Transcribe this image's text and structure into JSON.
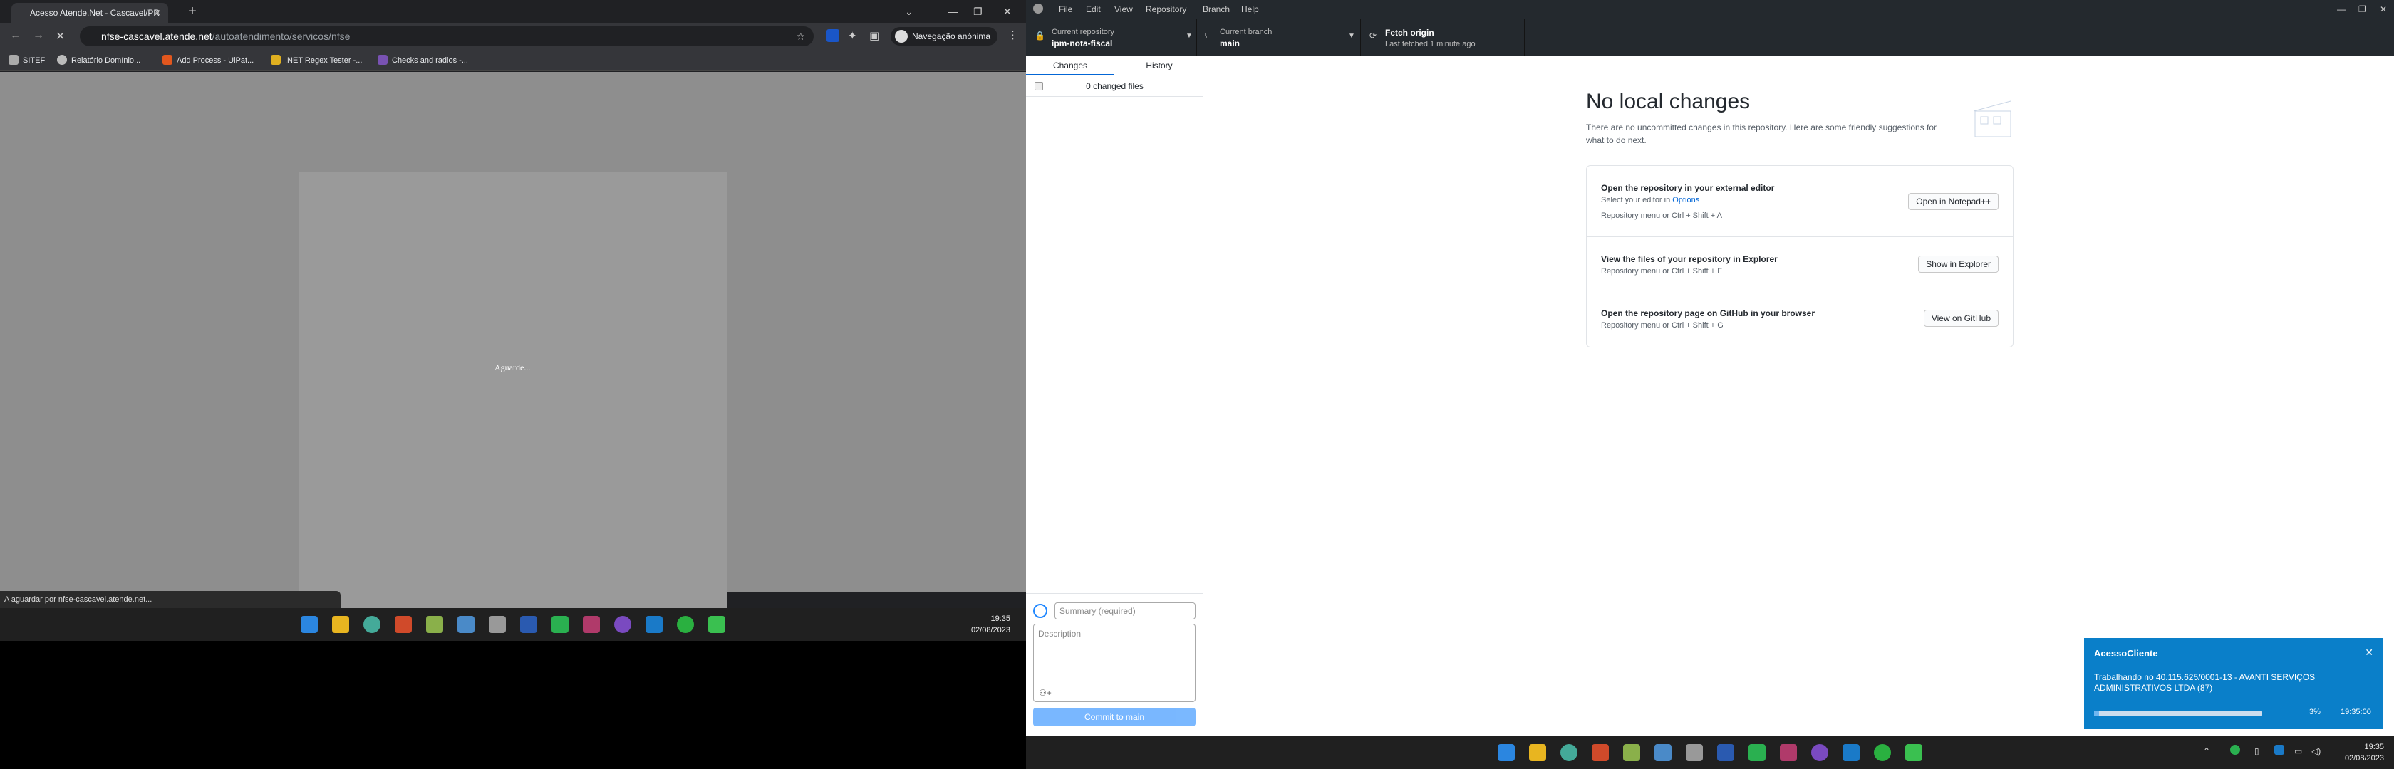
{
  "browser": {
    "tab_title": "Acesso Atende.Net - Cascavel/PR",
    "url_host": "nfse-cascavel.atende.net",
    "url_path": "/autoatendimento/servicos/nfse",
    "profile_label": "Navegação anónima",
    "bookmarks": [
      "SITEF",
      "Relatório Domínio...",
      "Add Process - UiPat...",
      ".NET Regex Tester -...",
      "Checks and radios -..."
    ],
    "loading_text": "Aguarde...",
    "status_text": "A aguardar por nfse-cascavel.atende.net...",
    "clock_time": "19:35",
    "clock_date": "02/08/2023"
  },
  "github": {
    "menu": [
      "File",
      "Edit",
      "View",
      "Repository",
      "Branch",
      "Help"
    ],
    "repo_label": "Current repository",
    "repo_name": "ipm-nota-fiscal",
    "branch_label": "Current branch",
    "branch_name": "main",
    "fetch_label": "Fetch origin",
    "fetch_sub": "Last fetched 1 minute ago",
    "tab_changes": "Changes",
    "tab_history": "History",
    "changed_files": "0 changed files",
    "summary_placeholder": "Summary (required)",
    "description_placeholder": "Description",
    "commit_button": "Commit to main",
    "no_changes_title": "No local changes",
    "no_changes_sub": "There are no uncommitted changes in this repository. Here are some friendly suggestions for what to do next.",
    "cards": [
      {
        "title": "Open the repository in your external editor",
        "line1_prefix": "Select your editor in ",
        "line1_link": "Options",
        "hint": "Repository menu or  Ctrl + Shift + A",
        "button": "Open in Notepad++"
      },
      {
        "title": "View the files of your repository in Explorer",
        "hint": "Repository menu or  Ctrl + Shift + F",
        "button": "Show in Explorer"
      },
      {
        "title": "Open the repository page on GitHub in your browser",
        "hint": "Repository menu or  Ctrl + Shift + G",
        "button": "View on GitHub"
      }
    ]
  },
  "toast": {
    "title": "AcessoCliente",
    "message": "Trabalhando no 40.115.625/0001-13 - AVANTI SERVIÇOS ADMINISTRATIVOS LTDA (87)",
    "progress_label": "3%",
    "progress": 0.03,
    "time": "19:35:00"
  },
  "taskbar2": {
    "time": "19:35",
    "date": "02/08/2023"
  },
  "colors": {
    "accent": "#0366d6",
    "toast": "#0a7fc9",
    "chrome_dark": "#202124"
  }
}
